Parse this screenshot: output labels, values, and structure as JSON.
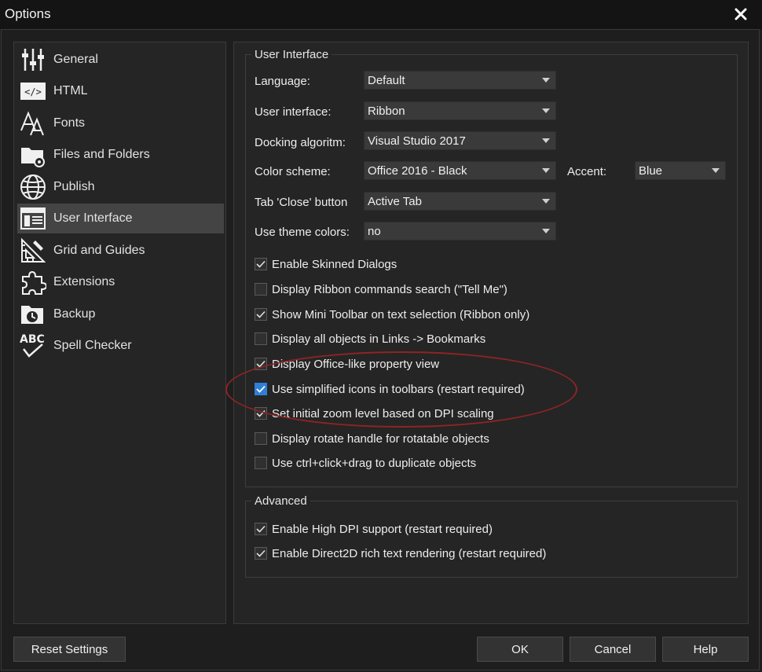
{
  "window": {
    "title": "Options"
  },
  "sidebar": {
    "items": [
      {
        "label": "General",
        "icon": "sliders-icon"
      },
      {
        "label": "HTML",
        "icon": "html-tag-icon"
      },
      {
        "label": "Fonts",
        "icon": "font-icon"
      },
      {
        "label": "Files and Folders",
        "icon": "folder-gear-icon"
      },
      {
        "label": "Publish",
        "icon": "globe-icon"
      },
      {
        "label": "User Interface",
        "icon": "ui-layout-icon"
      },
      {
        "label": "Grid and Guides",
        "icon": "grid-ruler-icon"
      },
      {
        "label": "Extensions",
        "icon": "puzzle-icon"
      },
      {
        "label": "Backup",
        "icon": "folder-clock-icon"
      },
      {
        "label": "Spell Checker",
        "icon": "abc-check-icon"
      }
    ],
    "active_index": 5
  },
  "user_interface": {
    "group_title": "User Interface",
    "language": {
      "label": "Language:",
      "value": "Default"
    },
    "ui_mode": {
      "label": "User interface:",
      "value": "Ribbon"
    },
    "docking": {
      "label": "Docking algoritm:",
      "value": "Visual Studio 2017"
    },
    "color_scheme": {
      "label": "Color scheme:",
      "value": "Office 2016 - Black"
    },
    "accent": {
      "label": "Accent:",
      "value": "Blue"
    },
    "tab_close": {
      "label": "Tab 'Close' button",
      "value": "Active Tab"
    },
    "theme_colors": {
      "label": "Use theme colors:",
      "value": "no"
    },
    "checkboxes": [
      {
        "label": "Enable Skinned Dialogs",
        "checked": true
      },
      {
        "label": "Display Ribbon commands search (\"Tell Me\")",
        "checked": false
      },
      {
        "label": "Show Mini Toolbar on text selection (Ribbon only)",
        "checked": true
      },
      {
        "label": "Display all objects in Links -> Bookmarks",
        "checked": false
      },
      {
        "label": "Display Office-like property view",
        "checked": true
      },
      {
        "label": "Use simplified icons in toolbars (restart required)",
        "checked": true
      },
      {
        "label": "Set initial zoom level based on DPI scaling",
        "checked": true
      },
      {
        "label": "Display rotate handle for rotatable objects",
        "checked": false
      },
      {
        "label": "Use ctrl+click+drag to duplicate objects",
        "checked": false
      }
    ]
  },
  "advanced": {
    "group_title": "Advanced",
    "checkboxes": [
      {
        "label": "Enable High DPI support (restart required)",
        "checked": true
      },
      {
        "label": "Enable Direct2D rich text rendering (restart required)",
        "checked": true
      }
    ]
  },
  "buttons": {
    "reset": "Reset Settings",
    "ok": "OK",
    "cancel": "Cancel",
    "help": "Help"
  },
  "colors": {
    "accent_checkbox": "#2f7fd6",
    "annotation_ellipse": "#8e2424",
    "background": "#1e1e1e",
    "panel": "#252525"
  }
}
